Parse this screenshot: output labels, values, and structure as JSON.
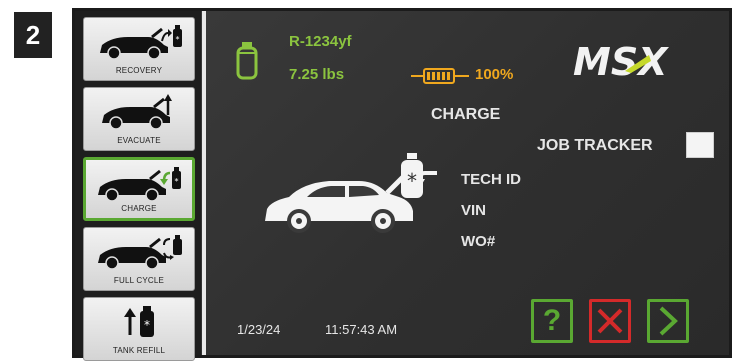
{
  "step_number": "2",
  "colors": {
    "accent_green": "#5aa832",
    "refrigerant_green": "#8bc43f",
    "battery_orange": "#f0a81e",
    "cancel_red": "#d42a2a",
    "screen_bg": "#333333"
  },
  "sidebar": {
    "items": [
      {
        "label": "RECOVERY",
        "icon": "car-recovery-icon",
        "active": false
      },
      {
        "label": "EVACUATE",
        "icon": "car-evacuate-icon",
        "active": false
      },
      {
        "label": "CHARGE",
        "icon": "car-charge-icon",
        "active": true
      },
      {
        "label": "FULL CYCLE",
        "icon": "car-full-cycle-icon",
        "active": false
      },
      {
        "label": "TANK REFILL",
        "icon": "tank-refill-icon",
        "active": false
      }
    ]
  },
  "status": {
    "refrigerant": "R-1234yf",
    "weight": "7.25 lbs",
    "battery_percent": "100%"
  },
  "brand": {
    "logo_text": "MSX"
  },
  "main": {
    "mode_title": "CHARGE",
    "job_tracker_label": "JOB TRACKER",
    "job_tracker_checked": false,
    "fields": {
      "tech_id_label": "TECH ID",
      "vin_label": "VIN",
      "wo_label": "WO#"
    }
  },
  "footer": {
    "date": "1/23/24",
    "time": "11:57:43 AM",
    "help_label": "?",
    "help_icon": "question-icon",
    "cancel_icon": "x-icon",
    "next_icon": "chevron-right-icon"
  }
}
